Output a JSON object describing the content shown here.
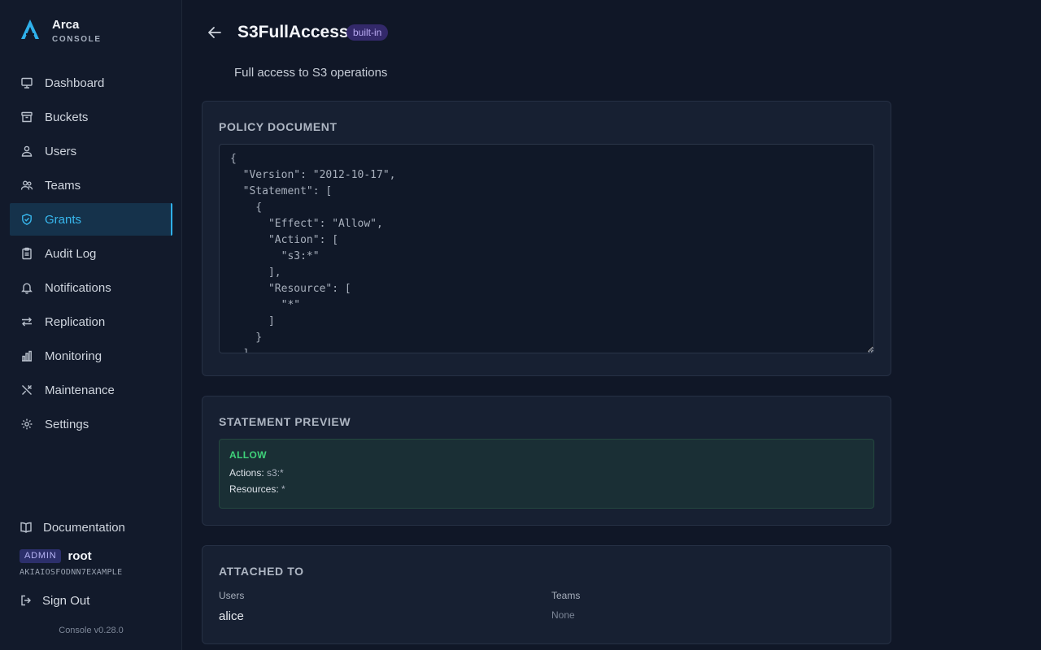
{
  "brand": {
    "name": "Arca",
    "subtitle": "CONSOLE"
  },
  "nav": [
    {
      "label": "Dashboard",
      "icon": "monitor-icon",
      "active": false
    },
    {
      "label": "Buckets",
      "icon": "archive-icon",
      "active": false
    },
    {
      "label": "Users",
      "icon": "user-icon",
      "active": false
    },
    {
      "label": "Teams",
      "icon": "users-icon",
      "active": false
    },
    {
      "label": "Grants",
      "icon": "shield-icon",
      "active": true
    },
    {
      "label": "Audit Log",
      "icon": "clipboard-icon",
      "active": false
    },
    {
      "label": "Notifications",
      "icon": "bell-icon",
      "active": false
    },
    {
      "label": "Replication",
      "icon": "arrows-icon",
      "active": false
    },
    {
      "label": "Monitoring",
      "icon": "bar-chart-icon",
      "active": false
    },
    {
      "label": "Maintenance",
      "icon": "tools-icon",
      "active": false
    },
    {
      "label": "Settings",
      "icon": "gear-icon",
      "active": false
    }
  ],
  "footer": {
    "docs_label": "Documentation",
    "role_badge": "ADMIN",
    "username": "root",
    "access_key": "AKIAIOSFODNN7EXAMPLE",
    "signout_label": "Sign Out",
    "version": "Console v0.28.0"
  },
  "page": {
    "title": "S3FullAccess",
    "badge": "built-in",
    "description": "Full access to S3 operations"
  },
  "policy": {
    "title": "Policy Document",
    "document": "{\n  \"Version\": \"2012-10-17\",\n  \"Statement\": [\n    {\n      \"Effect\": \"Allow\",\n      \"Action\": [\n        \"s3:*\"\n      ],\n      \"Resource\": [\n        \"*\"\n      ]\n    }\n  ]\n}"
  },
  "preview": {
    "title": "Statement Preview",
    "effect": "ALLOW",
    "actions_label": "Actions:",
    "actions_value": "s3:*",
    "resources_label": "Resources:",
    "resources_value": "*"
  },
  "attached": {
    "title": "Attached To",
    "users_label": "Users",
    "users_value": "alice",
    "teams_label": "Teams",
    "teams_value": "None"
  },
  "colors": {
    "background": "#101727",
    "sidebar": "#121a2b",
    "accent": "#38b8ee",
    "allow": "#3fd27a",
    "badge_purple": "#33296a"
  }
}
